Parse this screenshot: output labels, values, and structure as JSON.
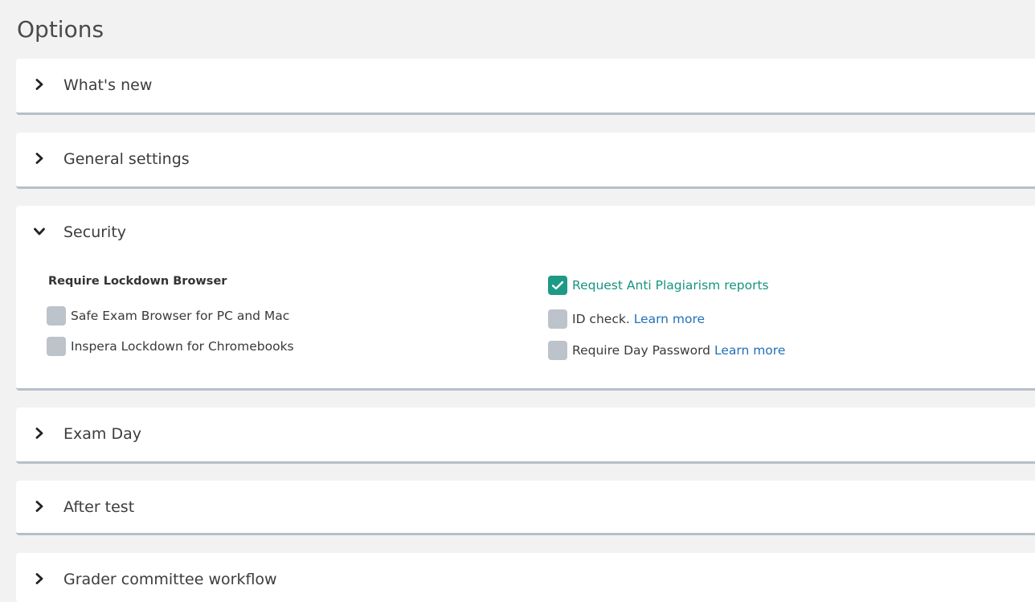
{
  "page": {
    "title": "Options"
  },
  "panels": {
    "whats_new": {
      "label": "What's new",
      "expanded": false,
      "icon": "chevron-right-icon"
    },
    "general_settings": {
      "label": "General settings",
      "expanded": false,
      "icon": "chevron-right-icon"
    },
    "security": {
      "label": "Security",
      "expanded": true,
      "icon": "chevron-down-icon",
      "lockdown_heading": "Require Lockdown Browser",
      "lockdown_options": [
        {
          "label": "Safe Exam Browser for PC and Mac",
          "checked": false
        },
        {
          "label": "Inspera Lockdown for Chromebooks",
          "checked": false
        }
      ],
      "right_options": {
        "anti_plagiarism": {
          "label": "Request Anti Plagiarism reports",
          "checked": true
        },
        "id_check": {
          "label": "ID check.",
          "link": "Learn more",
          "checked": false
        },
        "day_password": {
          "label": "Require Day Password",
          "link": "Learn more",
          "checked": false
        }
      }
    },
    "exam_day": {
      "label": "Exam Day",
      "expanded": false,
      "icon": "chevron-right-icon"
    },
    "after_test": {
      "label": "After test",
      "expanded": false,
      "icon": "chevron-right-icon"
    },
    "grader_committee": {
      "label": "Grader committee workflow",
      "expanded": false,
      "icon": "chevron-right-icon"
    }
  },
  "colors": {
    "background": "#f2f2f2",
    "panel": "#ffffff",
    "panel_border": "#b6bfc8",
    "checkbox_unchecked": "#bcc3ca",
    "checkbox_checked": "#1c9a86",
    "checked_text": "#16947f",
    "link": "#2171b8"
  }
}
